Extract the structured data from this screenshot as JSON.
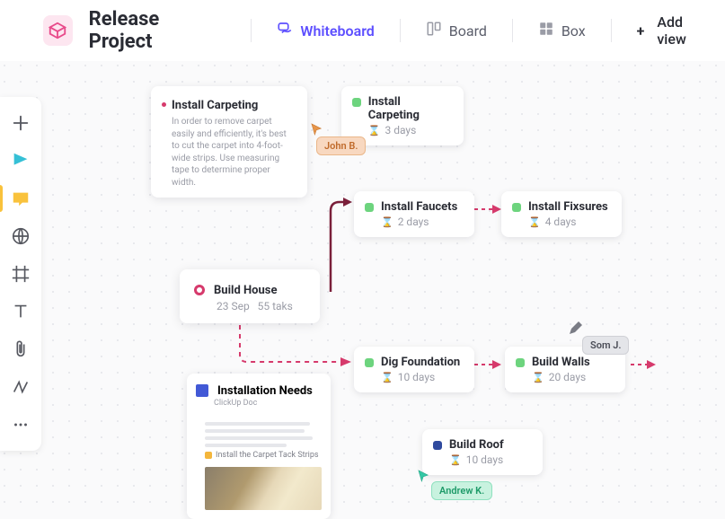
{
  "header": {
    "title": "Release Project",
    "views": {
      "whiteboard": "Whiteboard",
      "board": "Board",
      "box": "Box",
      "add": "Add view"
    }
  },
  "colors": {
    "accent_purple": "#5d4fff",
    "accent_pink": "#d63a6c",
    "status_green": "#6dd47e",
    "status_navy": "#2f4a9e"
  },
  "note": {
    "title": "Install Carpeting",
    "body": "In order to remove carpet easily and efficiently, it's best to cut the carpet into 4-foot-wide strips. Use measuring tape to determine proper width."
  },
  "tasks": {
    "carpeting": {
      "title": "Install Carpeting",
      "duration": "3 days"
    },
    "faucets": {
      "title": "Install Faucets",
      "duration": "2 days"
    },
    "fixtures": {
      "title": "Install Fixsures",
      "duration": "4 days"
    },
    "dig": {
      "title": "Dig Foundation",
      "duration": "10 days"
    },
    "walls": {
      "title": "Build Walls",
      "duration": "20 days"
    },
    "roof": {
      "title": "Build Roof",
      "duration": "10 days"
    }
  },
  "hub": {
    "title": "Build House",
    "date": "23 Sep",
    "tasks": "55 taks"
  },
  "doc": {
    "title": "Installation Needs",
    "sub": "ClickUp Doc",
    "section": "Install the Carpet Tack Strips"
  },
  "users": {
    "john": "John B.",
    "som": "Som J.",
    "andrew": "Andrew K."
  }
}
